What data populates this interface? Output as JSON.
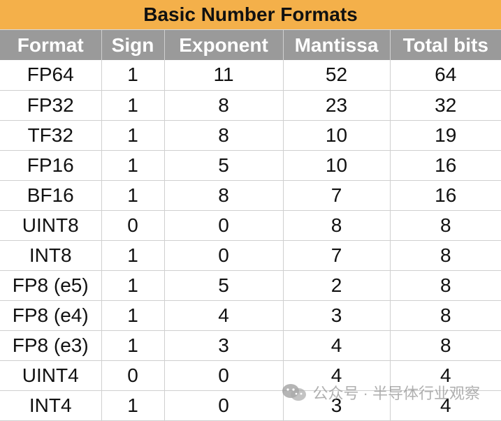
{
  "title": "Basic Number Formats",
  "columns": [
    "Format",
    "Sign",
    "Exponent",
    "Mantissa",
    "Total bits"
  ],
  "rows": [
    [
      "FP64",
      "1",
      "11",
      "52",
      "64"
    ],
    [
      "FP32",
      "1",
      "8",
      "23",
      "32"
    ],
    [
      "TF32",
      "1",
      "8",
      "10",
      "19"
    ],
    [
      "FP16",
      "1",
      "5",
      "10",
      "16"
    ],
    [
      "BF16",
      "1",
      "8",
      "7",
      "16"
    ],
    [
      "UINT8",
      "0",
      "0",
      "8",
      "8"
    ],
    [
      "INT8",
      "1",
      "0",
      "7",
      "8"
    ],
    [
      "FP8 (e5)",
      "1",
      "5",
      "2",
      "8"
    ],
    [
      "FP8 (e4)",
      "1",
      "4",
      "3",
      "8"
    ],
    [
      "FP8 (e3)",
      "1",
      "3",
      "4",
      "8"
    ],
    [
      "UINT4",
      "0",
      "0",
      "4",
      "4"
    ],
    [
      "INT4",
      "1",
      "0",
      "3",
      "4"
    ]
  ],
  "watermark": {
    "text": "公众号 · 半导体行业观察",
    "icon": "wechat-icon"
  },
  "colors": {
    "title_bg": "#f4b04a",
    "header_bg": "#9a9a9a",
    "header_text": "#ffffff"
  }
}
